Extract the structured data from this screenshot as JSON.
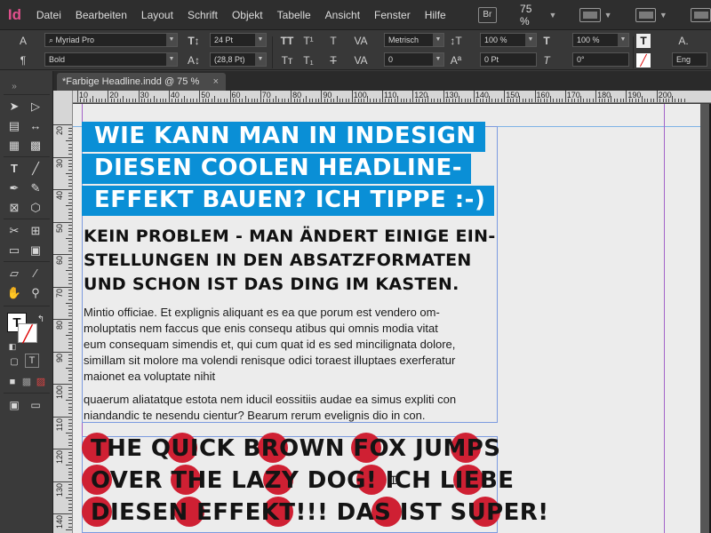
{
  "menubar": {
    "app_logo": "Id",
    "items": [
      "Datei",
      "Bearbeiten",
      "Layout",
      "Schrift",
      "Objekt",
      "Tabelle",
      "Ansicht",
      "Fenster",
      "Hilfe"
    ],
    "bridge_label": "Br",
    "zoom": "75 %"
  },
  "controlpanel": {
    "font_family": "Myriad Pro",
    "font_style": "Bold",
    "font_size": "24 Pt",
    "leading": "(28,8 Pt)",
    "kerning": "Metrisch",
    "tracking": "0",
    "vertical_scale": "100 %",
    "baseline_shift": "0 Pt",
    "horizontal_scale": "100 %",
    "skew": "0°",
    "language": "Eng"
  },
  "tab": {
    "title": "*Farbige Headline.indd @ 75 %",
    "close": "×"
  },
  "ruler": {
    "h_labels": [
      "10",
      "20",
      "30",
      "40",
      "50",
      "60",
      "70",
      "80",
      "90",
      "100",
      "110",
      "120",
      "130",
      "140",
      "150",
      "160",
      "170",
      "180",
      "190",
      "200"
    ],
    "v_labels": [
      "20",
      "30",
      "40",
      "50",
      "60",
      "70",
      "80",
      "90",
      "100",
      "110",
      "120",
      "130",
      "140"
    ]
  },
  "document": {
    "headline_blue": [
      "WIE KANN MAN IN INDESIGN",
      "DIESEN COOLEN HEADLINE-",
      "EFFEKT BAUEN? ICH TIPPE :-)"
    ],
    "headline2": [
      "KEIN PROBLEM - MAN ÄNDERT EINIGE EIN-",
      "STELLUNGEN IN DEN ABSATZFORMATEN",
      "UND SCHON IST DAS DING IM KASTEN."
    ],
    "body1": [
      "Mintio officiae. Et explignis aliquant es ea que porum est vendero om-",
      "moluptatis nem faccus que enis consequ atibus qui omnis modia vitat",
      "eum consequam simendis et, qui cum quat id es sed mincilignata dolore,",
      "simillam sit molore ma volendi renisque odici toraest illuptaes exerferatur",
      "maionet ea voluptate nihit"
    ],
    "body2": [
      "quaerum aliatatque estota nem iducil eossitiis audae ea simus expliti con",
      "niandandic te nesendu cientur? Bearum rerum evelignis dio in con."
    ],
    "headline_dots": [
      "THE QUICK BROWN FOX JUMPS",
      "OVER THE LAZY DOG! ICH LIEBE",
      "DIESEN EFFEKT!!! DAS IST SUPER!"
    ],
    "colors": {
      "highlight_blue": "#0a8fd6",
      "dot_red": "#cf2033",
      "page": "#ececec"
    }
  }
}
